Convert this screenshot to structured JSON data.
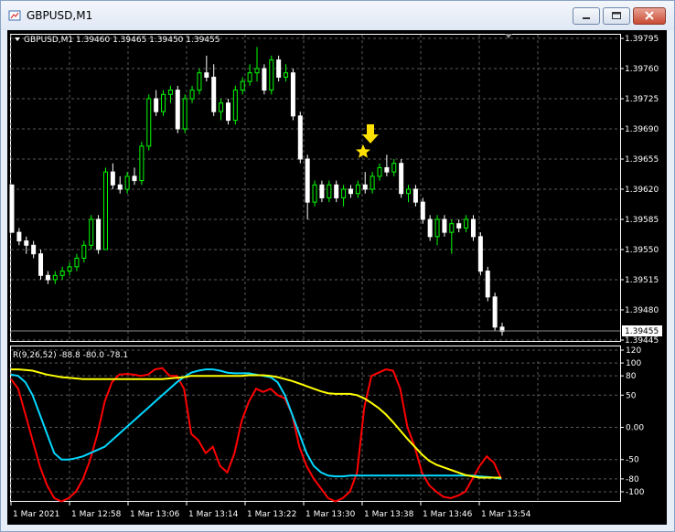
{
  "window": {
    "title": "GBPUSD,M1"
  },
  "main_chart": {
    "header": "GBPUSD,M1  1.39460 1.39465 1.39450 1.39455",
    "price_labels": [
      "1.39795",
      "1.39760",
      "1.39725",
      "1.39690",
      "1.39655",
      "1.39620",
      "1.39585",
      "1.39550",
      "1.39515",
      "1.39480",
      "1.39445"
    ],
    "current_price": "1.39455",
    "colors": {
      "background": "#000000",
      "bull": "#00ff00",
      "bear": "#ffffff",
      "grid": "#5a5a5a",
      "signal": "#ffe000"
    },
    "signal_icons": [
      "arrow-down-icon",
      "star-icon"
    ]
  },
  "indicator": {
    "header": "R(9,26,52) -88.8 -80.0 -78.1",
    "scale_labels": [
      "120",
      "100",
      "80",
      "50",
      "0.00",
      "-50",
      "-80",
      "-100"
    ],
    "colors": {
      "fast": "#ff0000",
      "mid": "#00d8ff",
      "slow": "#ffff00"
    }
  },
  "time_axis": [
    "1 Mar 2021",
    "1 Mar 12:58",
    "1 Mar 13:06",
    "1 Mar 13:14",
    "1 Mar 13:22",
    "1 Mar 13:30",
    "1 Mar 13:38",
    "1 Mar 13:46",
    "1 Mar 13:54"
  ],
  "chart_data": {
    "type": "candlestick",
    "ylim": [
      1.39445,
      1.39795
    ],
    "candles": [
      [
        1.39625,
        1.39625,
        1.3957,
        1.3957
      ],
      [
        1.3957,
        1.39575,
        1.39555,
        1.3956
      ],
      [
        1.3956,
        1.39565,
        1.39545,
        1.39555
      ],
      [
        1.39555,
        1.3956,
        1.3954,
        1.39545
      ],
      [
        1.39545,
        1.3955,
        1.39515,
        1.3952
      ],
      [
        1.3952,
        1.39525,
        1.3951,
        1.39515
      ],
      [
        1.39515,
        1.39525,
        1.3951,
        1.3952
      ],
      [
        1.3952,
        1.3953,
        1.39515,
        1.39525
      ],
      [
        1.39525,
        1.39535,
        1.3952,
        1.3953
      ],
      [
        1.3953,
        1.39545,
        1.39525,
        1.3954
      ],
      [
        1.3954,
        1.3956,
        1.39535,
        1.39555
      ],
      [
        1.39555,
        1.3959,
        1.3955,
        1.39585
      ],
      [
        1.39585,
        1.3959,
        1.39545,
        1.3955
      ],
      [
        1.3955,
        1.39645,
        1.3955,
        1.3964
      ],
      [
        1.3964,
        1.3965,
        1.3962,
        1.39625
      ],
      [
        1.39625,
        1.39635,
        1.39615,
        1.3962
      ],
      [
        1.3962,
        1.3964,
        1.39615,
        1.39635
      ],
      [
        1.39635,
        1.39645,
        1.39625,
        1.3963
      ],
      [
        1.3963,
        1.39675,
        1.39625,
        1.3967
      ],
      [
        1.3967,
        1.3973,
        1.39665,
        1.39725
      ],
      [
        1.39725,
        1.39735,
        1.39705,
        1.3971
      ],
      [
        1.3971,
        1.39735,
        1.39705,
        1.3973
      ],
      [
        1.3973,
        1.3974,
        1.3972,
        1.39735
      ],
      [
        1.39735,
        1.3974,
        1.39685,
        1.3969
      ],
      [
        1.3969,
        1.3973,
        1.39685,
        1.39725
      ],
      [
        1.39725,
        1.3974,
        1.3972,
        1.39735
      ],
      [
        1.39735,
        1.3976,
        1.3973,
        1.39755
      ],
      [
        1.39755,
        1.39775,
        1.39745,
        1.3975
      ],
      [
        1.3975,
        1.39765,
        1.39705,
        1.3971
      ],
      [
        1.3971,
        1.39725,
        1.397,
        1.3972
      ],
      [
        1.3972,
        1.39725,
        1.39695,
        1.397
      ],
      [
        1.397,
        1.3974,
        1.39695,
        1.39735
      ],
      [
        1.39735,
        1.3975,
        1.3973,
        1.39745
      ],
      [
        1.39745,
        1.39765,
        1.3974,
        1.39755
      ],
      [
        1.39755,
        1.39785,
        1.39745,
        1.3976
      ],
      [
        1.3976,
        1.39765,
        1.3973,
        1.39735
      ],
      [
        1.39735,
        1.39775,
        1.3973,
        1.3977
      ],
      [
        1.3977,
        1.39775,
        1.39745,
        1.3975
      ],
      [
        1.3975,
        1.39765,
        1.39745,
        1.39755
      ],
      [
        1.39755,
        1.3976,
        1.397,
        1.39705
      ],
      [
        1.39705,
        1.3971,
        1.3965,
        1.39655
      ],
      [
        1.39655,
        1.3966,
        1.39585,
        1.39605
      ],
      [
        1.39605,
        1.3963,
        1.396,
        1.39625
      ],
      [
        1.39625,
        1.3963,
        1.39605,
        1.3961
      ],
      [
        1.3961,
        1.3963,
        1.39605,
        1.39625
      ],
      [
        1.39625,
        1.3963,
        1.39605,
        1.3961
      ],
      [
        1.3961,
        1.39625,
        1.396,
        1.3962
      ],
      [
        1.3962,
        1.39625,
        1.3961,
        1.39615
      ],
      [
        1.39615,
        1.3963,
        1.3961,
        1.39625
      ],
      [
        1.39625,
        1.3964,
        1.39615,
        1.3962
      ],
      [
        1.3962,
        1.3964,
        1.39615,
        1.39635
      ],
      [
        1.39635,
        1.3965,
        1.3963,
        1.39645
      ],
      [
        1.39645,
        1.3966,
        1.39635,
        1.3964
      ],
      [
        1.3964,
        1.39655,
        1.39635,
        1.3965
      ],
      [
        1.3965,
        1.39655,
        1.3961,
        1.39615
      ],
      [
        1.39615,
        1.39625,
        1.39605,
        1.3962
      ],
      [
        1.3962,
        1.39625,
        1.396,
        1.39605
      ],
      [
        1.39605,
        1.3961,
        1.3958,
        1.39585
      ],
      [
        1.39585,
        1.3959,
        1.3956,
        1.39565
      ],
      [
        1.39565,
        1.3959,
        1.39555,
        1.39585
      ],
      [
        1.39585,
        1.3959,
        1.39565,
        1.3957
      ],
      [
        1.3957,
        1.39585,
        1.39545,
        1.3958
      ],
      [
        1.3958,
        1.39585,
        1.3957,
        1.39575
      ],
      [
        1.39575,
        1.3959,
        1.3957,
        1.39585
      ],
      [
        1.39585,
        1.3959,
        1.3956,
        1.39565
      ],
      [
        1.39565,
        1.3957,
        1.3952,
        1.39525
      ],
      [
        1.39525,
        1.3953,
        1.3949,
        1.39495
      ],
      [
        1.39495,
        1.395,
        1.39455,
        1.3946
      ],
      [
        1.3946,
        1.39465,
        1.3945,
        1.39455
      ]
    ],
    "indicator_series": [
      {
        "name": "R(9)",
        "values": [
          75,
          60,
          20,
          -20,
          -60,
          -90,
          -110,
          -115,
          -110,
          -100,
          -80,
          -50,
          -10,
          40,
          70,
          82,
          83,
          82,
          80,
          82,
          90,
          92,
          80,
          80,
          60,
          -10,
          -20,
          -40,
          -30,
          -60,
          -70,
          -40,
          10,
          40,
          60,
          55,
          60,
          50,
          45,
          20,
          -30,
          -60,
          -80,
          -95,
          -110,
          -115,
          -110,
          -100,
          -70,
          30,
          80,
          85,
          90,
          88,
          60,
          0,
          -30,
          -70,
          -90,
          -100,
          -108,
          -110,
          -106,
          -100,
          -80,
          -60,
          -45,
          -55,
          -80
        ]
      },
      {
        "name": "R(26)",
        "values": [
          82,
          80,
          70,
          50,
          20,
          -10,
          -40,
          -50,
          -50,
          -48,
          -45,
          -40,
          -35,
          -30,
          -20,
          -10,
          0,
          10,
          20,
          30,
          40,
          50,
          60,
          70,
          78,
          85,
          88,
          90,
          90,
          88,
          85,
          84,
          84,
          84,
          82,
          80,
          78,
          70,
          50,
          20,
          -10,
          -40,
          -60,
          -70,
          -75,
          -76,
          -76,
          -75,
          -75,
          -75,
          -75,
          -75,
          -75,
          -75,
          -75,
          -75,
          -75,
          -75,
          -75,
          -75,
          -75,
          -75,
          -75,
          -75,
          -75,
          -76,
          -77,
          -78,
          -80
        ]
      },
      {
        "name": "R(52)",
        "values": [
          90,
          90,
          89,
          88,
          85,
          82,
          80,
          78,
          77,
          76,
          75,
          75,
          75,
          75,
          75,
          75,
          75,
          75,
          75,
          75,
          75,
          75,
          76,
          77,
          78,
          80,
          80,
          80,
          80,
          80,
          80,
          80,
          80,
          81,
          81,
          81,
          80,
          78,
          75,
          72,
          68,
          64,
          60,
          56,
          53,
          52,
          52,
          52,
          50,
          45,
          38,
          30,
          20,
          8,
          -5,
          -18,
          -30,
          -42,
          -52,
          -58,
          -62,
          -66,
          -70,
          -74,
          -76,
          -78,
          -78,
          -78,
          -78
        ]
      }
    ]
  }
}
